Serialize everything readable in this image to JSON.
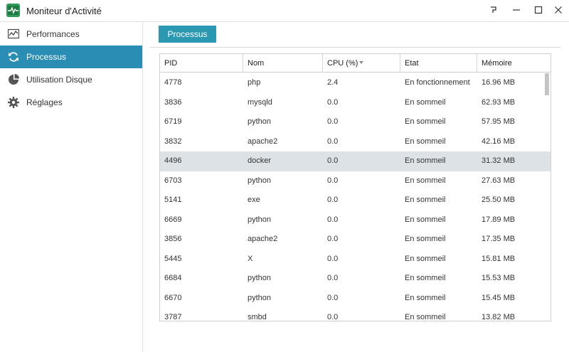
{
  "window": {
    "title": "Moniteur d'Activité",
    "controls": {
      "help": "help",
      "minimize": "minimize",
      "maximize": "maximize",
      "close": "close"
    }
  },
  "colors": {
    "accent": "#2a8db3",
    "tab": "#2a98b1",
    "selected_row": "#dde2e6",
    "app_icon": "#2f9d59"
  },
  "sidebar": {
    "items": [
      {
        "label": "Performances",
        "icon": "chart-icon",
        "active": false
      },
      {
        "label": "Processus",
        "icon": "refresh-icon",
        "active": true
      },
      {
        "label": "Utilisation Disque",
        "icon": "pie-chart-icon",
        "active": false
      },
      {
        "label": "Réglages",
        "icon": "gear-icon",
        "active": false
      }
    ]
  },
  "main": {
    "tab_label": "Processus",
    "table": {
      "columns": [
        "PID",
        "Nom",
        "CPU (%)",
        "Etat",
        "Mémoire"
      ],
      "sorted_column": "CPU (%)",
      "selected_row_index": 4,
      "rows": [
        [
          "4778",
          "php",
          "2.4",
          "En fonctionnement",
          "16.96 MB"
        ],
        [
          "3836",
          "mysqld",
          "0.0",
          "En sommeil",
          "62.93 MB"
        ],
        [
          "6719",
          "python",
          "0.0",
          "En sommeil",
          "57.95 MB"
        ],
        [
          "3832",
          "apache2",
          "0.0",
          "En sommeil",
          "42.16 MB"
        ],
        [
          "4496",
          "docker",
          "0.0",
          "En sommeil",
          "31.32 MB"
        ],
        [
          "6703",
          "python",
          "0.0",
          "En sommeil",
          "27.63 MB"
        ],
        [
          "5141",
          "exe",
          "0.0",
          "En sommeil",
          "25.50 MB"
        ],
        [
          "6669",
          "python",
          "0.0",
          "En sommeil",
          "17.89 MB"
        ],
        [
          "3856",
          "apache2",
          "0.0",
          "En sommeil",
          "17.35 MB"
        ],
        [
          "5445",
          "X",
          "0.0",
          "En sommeil",
          "15.81 MB"
        ],
        [
          "6684",
          "python",
          "0.0",
          "En sommeil",
          "15.53 MB"
        ],
        [
          "6670",
          "python",
          "0.0",
          "En sommeil",
          "15.45 MB"
        ],
        [
          "3787",
          "smbd",
          "0.0",
          "En sommeil",
          "13.82 MB"
        ]
      ]
    }
  }
}
